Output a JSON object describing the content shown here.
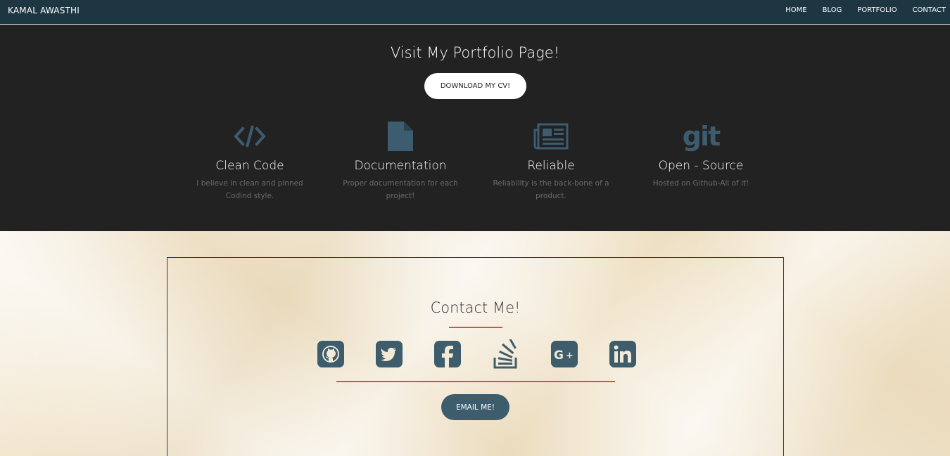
{
  "navbar": {
    "brand": "KAMAL AWASTHI",
    "links": [
      "HOME",
      "BLOG",
      "PORTFOLIO",
      "CONTACT"
    ]
  },
  "hero": {
    "title": "Visit My Portfolio Page!",
    "cv_button": "DOWNLOAD MY CV!",
    "features": [
      {
        "icon": "code-icon",
        "title": "Clean Code",
        "desc_line1": "I believe in clean and plnned",
        "desc_line2": "Codind style."
      },
      {
        "icon": "file-icon",
        "title": "Documentation",
        "desc_line1": "Proper documentation for each",
        "desc_line2": "project!"
      },
      {
        "icon": "newspaper-icon",
        "title": "Reliable",
        "desc_line1": "Reliability is the back-bone of a",
        "desc_line2": "product."
      },
      {
        "icon": "git-icon",
        "title": "Open - Source",
        "desc_line1": "Hosted on Github-All of it!",
        "desc_line2": ""
      }
    ],
    "git_glyph": "git"
  },
  "contact": {
    "title": "Contact Me!",
    "socials": [
      "github-icon",
      "twitter-icon",
      "facebook-icon",
      "stackoverflow-icon",
      "googleplus-icon",
      "linkedin-icon"
    ],
    "email_button": "EMAIL ME!"
  },
  "colors": {
    "navbar_bg": "#1d3642",
    "dark_bg": "#222222",
    "icon_blue": "#3d5c70",
    "accent_red": "#d9503d",
    "button_teal": "#3d5c6c"
  }
}
